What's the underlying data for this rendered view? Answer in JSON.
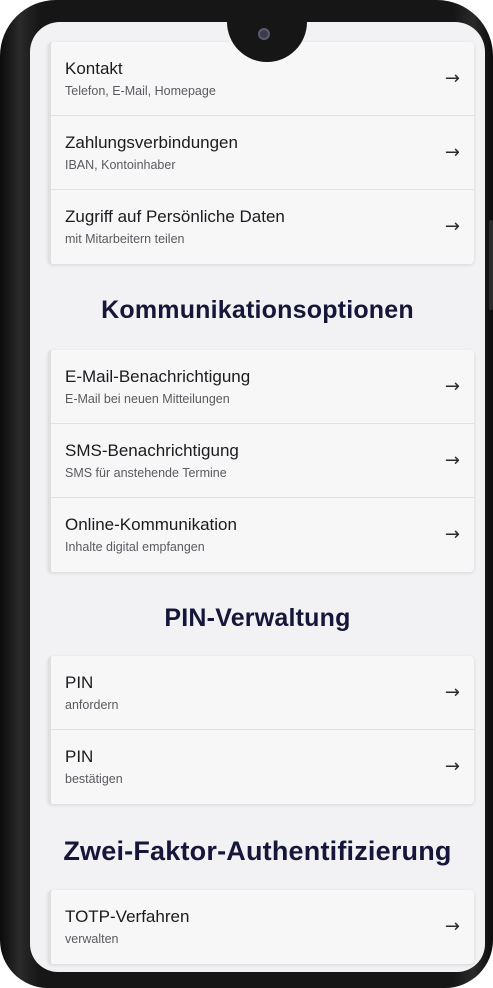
{
  "groups": {
    "personal": [
      {
        "title": "Kontakt",
        "subtitle": "Telefon, E-Mail, Homepage"
      },
      {
        "title": "Zahlungsverbindungen",
        "subtitle": "IBAN, Kontoinhaber"
      },
      {
        "title": "Zugriff auf Persönliche Daten",
        "subtitle": "mit Mitarbeitern teilen"
      }
    ],
    "communication": [
      {
        "title": "E-Mail-Benachrichtigung",
        "subtitle": "E-Mail bei neuen Mitteilungen"
      },
      {
        "title": "SMS-Benachrichtigung",
        "subtitle": "SMS für anstehende Termine"
      },
      {
        "title": "Online-Kommunikation",
        "subtitle": "Inhalte digital empfangen"
      }
    ],
    "pin": [
      {
        "title": "PIN",
        "subtitle": "anfordern"
      },
      {
        "title": "PIN",
        "subtitle": "bestätigen"
      }
    ],
    "twofa": [
      {
        "title": "TOTP-Verfahren",
        "subtitle": "verwalten"
      }
    ]
  },
  "headings": {
    "communication": "Kommunikationsoptionen",
    "pin": "PIN-Verwaltung",
    "twofa": "Zwei-Faktor-Authentifizierung"
  },
  "arrow_glyph": "→",
  "icons": {
    "row_arrow": "arrow-right-icon",
    "camera": "front-camera-icon"
  },
  "colors": {
    "heading": "#16163a",
    "card": "#f7f7f8",
    "screen_bg": "#f2f2f4"
  }
}
